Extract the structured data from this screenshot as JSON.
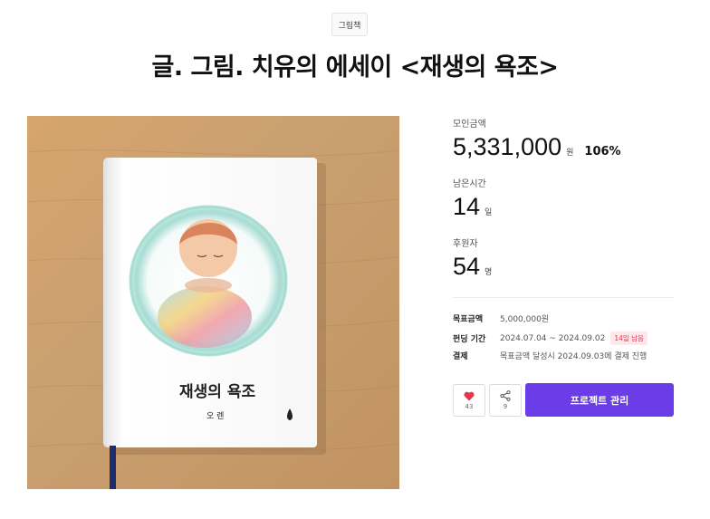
{
  "category": "그림책",
  "title": "글. 그림. 치유의 에세이 <재생의 욕조>",
  "book": {
    "cover_title": "재생의 욕조",
    "author": "오 렌"
  },
  "stats": {
    "amount_label": "모인금액",
    "amount_value": "5,331,000",
    "amount_unit": "원",
    "amount_percent": "106%",
    "time_label": "남은시간",
    "time_value": "14",
    "time_unit": "일",
    "backers_label": "후원자",
    "backers_value": "54",
    "backers_unit": "명"
  },
  "info": {
    "goal_key": "목표금액",
    "goal_val": "5,000,000원",
    "period_key": "펀딩 기간",
    "period_val": "2024.07.04 ~ 2024.09.02",
    "period_badge": "14일 남음",
    "payment_key": "결제",
    "payment_val": "목표금액 달성시 2024.09.03에 결제 진행"
  },
  "actions": {
    "like_count": "43",
    "share_count": "9",
    "manage_label": "프로젝트 관리"
  },
  "colors": {
    "accent": "#6a3de8",
    "like": "#e0384f"
  }
}
